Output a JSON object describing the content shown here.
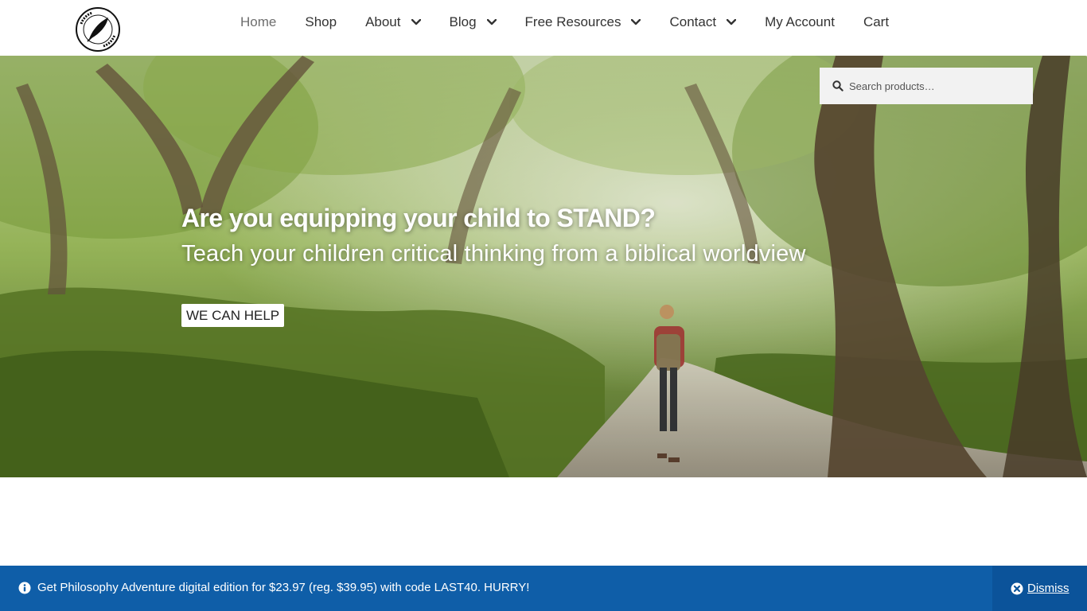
{
  "header": {
    "logo": {
      "icon": "quill-emblem-icon",
      "text": "HOMESCHOOL ADVENTURE"
    },
    "nav": [
      {
        "label": "Home",
        "active": true,
        "has_dropdown": false
      },
      {
        "label": "Shop",
        "active": false,
        "has_dropdown": false
      },
      {
        "label": "About",
        "active": false,
        "has_dropdown": true
      },
      {
        "label": "Blog",
        "active": false,
        "has_dropdown": true
      },
      {
        "label": "Free Resources",
        "active": false,
        "has_dropdown": true
      },
      {
        "label": "Contact",
        "active": false,
        "has_dropdown": true
      },
      {
        "label": "My Account",
        "active": false,
        "has_dropdown": false
      },
      {
        "label": "Cart",
        "active": false,
        "has_dropdown": false
      }
    ]
  },
  "search": {
    "placeholder": "Search products…",
    "icon": "search-icon"
  },
  "hero": {
    "title": "Are you equipping your child to STAND?",
    "subtitle": "Teach your children critical thinking from a biblical worldview",
    "button_label": "WE CAN HELP"
  },
  "notice": {
    "text": "Get Philosophy Adventure digital edition for $23.97 (reg. $39.95) with code LAST40. HURRY!",
    "dismiss_label": "Dismiss",
    "background": "#0f5ea8"
  }
}
